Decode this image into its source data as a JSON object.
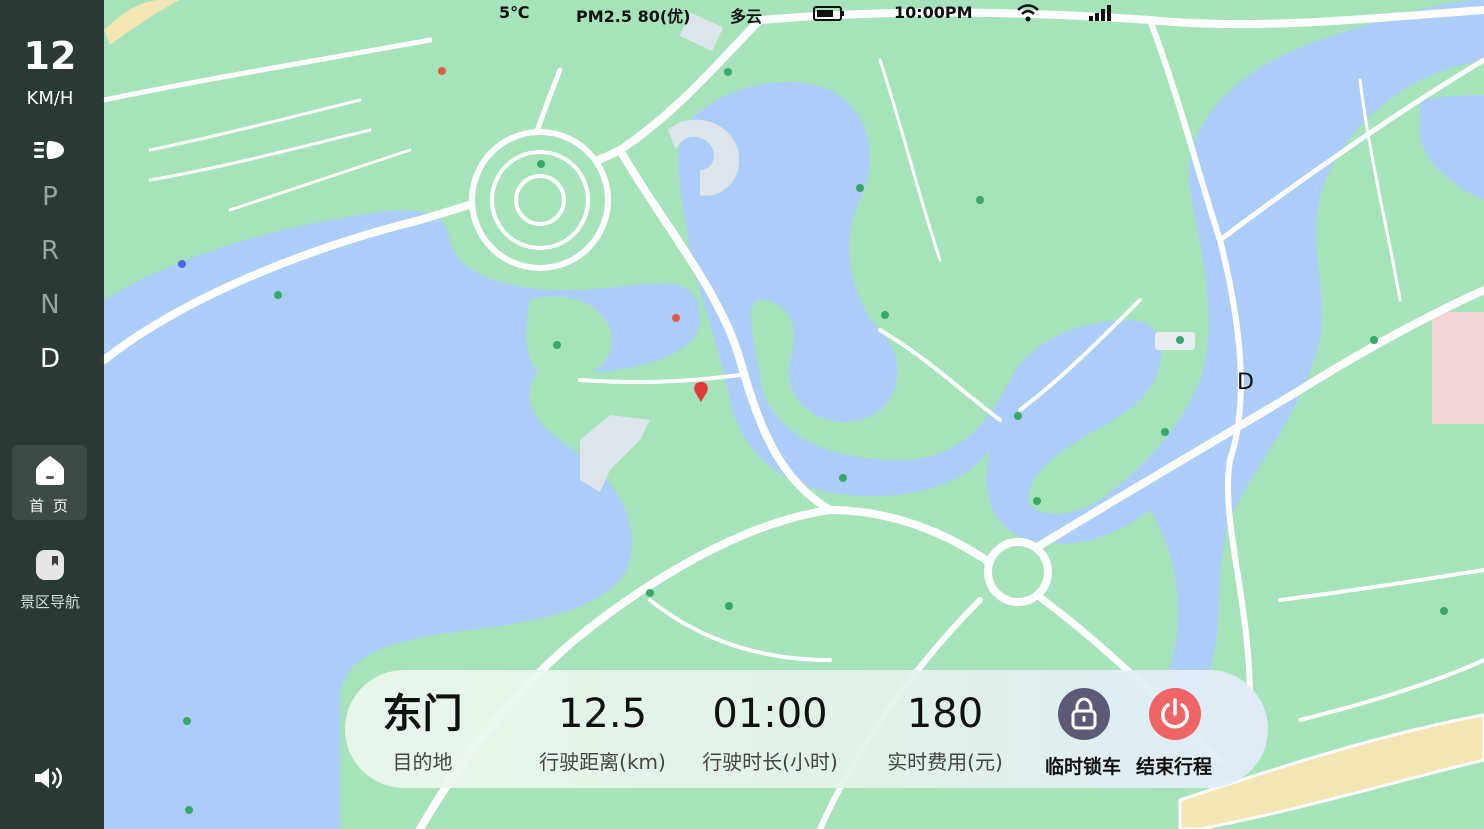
{
  "status": {
    "temperature": "5℃",
    "air_quality": "PM2.5 80(优)",
    "weather": "多云",
    "time": "10:00PM",
    "battery_icon": "battery-icon",
    "wifi_icon": "wifi-icon",
    "signal_icon": "signal-icon"
  },
  "sidebar": {
    "speed_value": "12",
    "speed_unit": "KM/H",
    "headlight_icon": "headlight-icon",
    "gears": [
      "P",
      "R",
      "N",
      "D"
    ],
    "active_gear": "D",
    "nav": [
      {
        "label": "首 页",
        "icon": "home-icon",
        "active": true
      },
      {
        "label": "景区导航",
        "icon": "map-pin-icon",
        "active": false
      }
    ],
    "volume_icon": "volume-icon"
  },
  "map": {
    "marker_label": "D",
    "colors": {
      "land": "#a6e3bb",
      "water": "#abcdf7",
      "road": "#ffffff"
    }
  },
  "trip": {
    "destination": {
      "value": "东门",
      "label": "目的地"
    },
    "distance": {
      "value": "12.5",
      "label": "行驶距离(km)"
    },
    "duration": {
      "value": "01:00",
      "label": "行驶时长(小时)"
    },
    "fee": {
      "value": "180",
      "label": "实时费用(元)"
    },
    "lock_button": {
      "label": "临时锁车",
      "icon": "lock-icon"
    },
    "end_button": {
      "label": "结束行程",
      "icon": "power-icon"
    }
  }
}
